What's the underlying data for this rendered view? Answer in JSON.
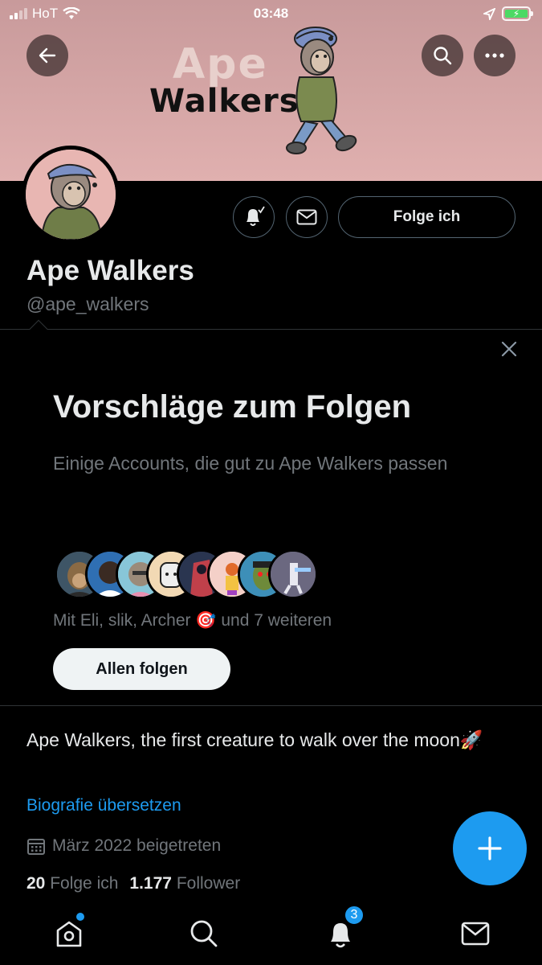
{
  "status_bar": {
    "carrier": "HoT",
    "time": "03:48",
    "battery_level": 1.0,
    "icons": [
      "signal-icon",
      "wifi-icon",
      "location-arrow-icon",
      "battery-charging-icon"
    ]
  },
  "banner": {
    "brand_line1": "Ape",
    "brand_line2": "Walkers"
  },
  "header_actions": {
    "back_icon": "back-arrow-icon",
    "search_icon": "search-icon",
    "more_icon": "more-icon"
  },
  "profile": {
    "name": "Ape Walkers",
    "handle": "@ape_walkers",
    "follow_label": "Folge ich",
    "notify_icon": "bell-check-icon",
    "message_icon": "envelope-icon"
  },
  "suggestions": {
    "title": "Vorschläge zum Folgen",
    "subtitle": "Einige Accounts, die gut zu Ape Walkers passen",
    "followers_text": "Mit Eli, slik, Archer 🎯 und 7 weiteren",
    "follow_all_label": "Allen folgen",
    "avatar_count": 8
  },
  "about": {
    "bio": "Ape Walkers, the first creature to walk over the moon🚀",
    "translate_label": "Biografie übersetzen",
    "joined": "März 2022 beigetreten",
    "following_count": "20",
    "following_label": "Folge ich",
    "followers_count": "1.177",
    "followers_label": "Follower"
  },
  "tabbar": {
    "tabs": [
      {
        "name": "home",
        "icon": "home-icon",
        "has_dot": true
      },
      {
        "name": "search",
        "icon": "search-icon"
      },
      {
        "name": "notifications",
        "icon": "bell-icon",
        "badge": "3"
      },
      {
        "name": "messages",
        "icon": "envelope-icon"
      }
    ],
    "notif_badge": "3"
  },
  "colors": {
    "accent": "#1d9bf0",
    "banner": "#d4a5a5",
    "background": "#000000",
    "secondary_text": "#71767b"
  }
}
